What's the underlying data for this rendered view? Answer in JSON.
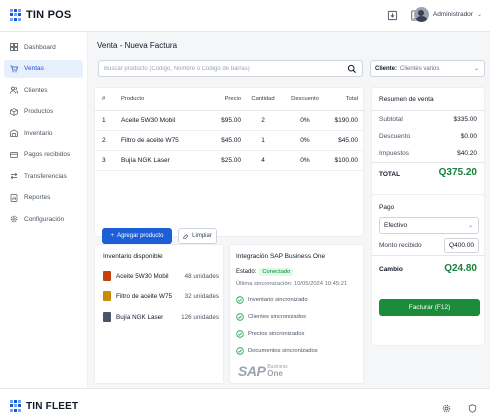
{
  "app": {
    "name": "TIN POS",
    "footer_name": "TIN FLEET"
  },
  "header": {
    "user_name": "Administrador",
    "icons": [
      "download-icon",
      "mobile-icon"
    ]
  },
  "sidebar": {
    "items": [
      {
        "label": "Dashboard",
        "icon": "grid-icon"
      },
      {
        "label": "Ventas",
        "icon": "cart-icon",
        "active": true
      },
      {
        "label": "Clientes",
        "icon": "users-icon"
      },
      {
        "label": "Productos",
        "icon": "box-icon"
      },
      {
        "label": "Inventario",
        "icon": "warehouse-icon"
      },
      {
        "label": "Pagos recibidos",
        "icon": "card-icon"
      },
      {
        "label": "Transferencias",
        "icon": "transfer-icon"
      },
      {
        "label": "Reportes",
        "icon": "report-icon"
      },
      {
        "label": "Configuración",
        "icon": "gear-icon"
      }
    ]
  },
  "page": {
    "title": "Venta - Nueva Factura"
  },
  "search": {
    "placeholder": "Buscar producto (Código, Nombre o Código de barras)"
  },
  "client": {
    "label": "Cliente:",
    "value": "Clientes varios"
  },
  "cart": {
    "headers": [
      "#",
      "Producto",
      "Precio",
      "Cantidad",
      "Descuento",
      "Total"
    ],
    "rows": [
      [
        "1",
        "Aceite 5W30 Mobil",
        "$95.00",
        "2",
        "0%",
        "$190.00"
      ],
      [
        "2",
        "Filtro de aceite W75",
        "$45.00",
        "1",
        "0%",
        "$45.00"
      ],
      [
        "3",
        "Bujía NGK Laser",
        "$25.00",
        "4",
        "0%",
        "$100.00"
      ]
    ],
    "add_label": "Agregar producto",
    "clear_label": "Limpiar"
  },
  "summary": {
    "title": "Resumen de venta",
    "subtotal_label": "Subtotal",
    "subtotal": "$335.00",
    "discount_label": "Descuento",
    "discount": "$0.00",
    "tax_label": "Impuestos",
    "tax": "$40.20",
    "total_label": "TOTAL",
    "total": "Q375.20"
  },
  "payment": {
    "title": "Pago",
    "method": "Efectivo",
    "received_label": "Monto recibido",
    "received": "Q400.00",
    "change_label": "Cambio",
    "change": "Q24.80",
    "invoice_label": "Facturar (F12)"
  },
  "inventory": {
    "title": "Inventario disponible",
    "items": [
      {
        "name": "Aceite 5W30 Mobil",
        "units": "48 unidades",
        "thumb_color": "#c2410c"
      },
      {
        "name": "Filtro de aceite W75",
        "units": "32 unidades",
        "thumb_color": "#ca8a04"
      },
      {
        "name": "Bujía NGK Laser",
        "units": "126 unidades",
        "thumb_color": "#475569"
      }
    ]
  },
  "sap": {
    "title": "Integración SAP Business One",
    "status_label": "Estado:",
    "status": "Conectado",
    "last_sync": "Última sincronización: 10/05/2024 10:45:21",
    "checks": [
      "Inventario sincronizado",
      "Clientes sincronizados",
      "Precios sincronizados",
      "Documentos sincronizados"
    ],
    "logo_sap": "SAP",
    "logo_business": "Business",
    "logo_one": "One"
  },
  "colors": {
    "accent": "#1d5fd6",
    "success": "#16803c",
    "active_bg": "#e8f0fe"
  }
}
